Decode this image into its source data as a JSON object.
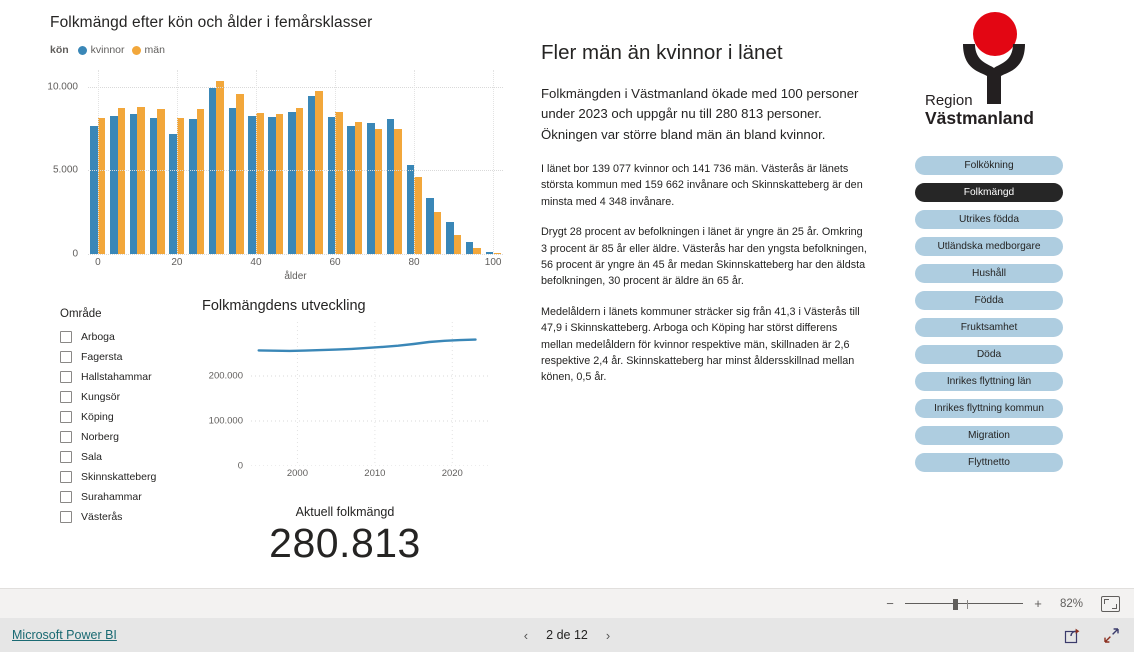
{
  "barchart": {
    "title": "Folkmängd efter kön och ålder i femårsklasser",
    "legend_title": "kön",
    "legend": [
      {
        "label": "kvinnor",
        "color": "#3a87b7"
      },
      {
        "label": "män",
        "color": "#f2a73b"
      }
    ]
  },
  "slicer": {
    "title": "Område",
    "items": [
      {
        "label": "Arboga",
        "checked": false
      },
      {
        "label": "Fagersta",
        "checked": false
      },
      {
        "label": "Hallstahammar",
        "checked": false
      },
      {
        "label": "Kungsör",
        "checked": false
      },
      {
        "label": "Köping",
        "checked": false
      },
      {
        "label": "Norberg",
        "checked": false
      },
      {
        "label": "Sala",
        "checked": false
      },
      {
        "label": "Skinnskatteberg",
        "checked": false
      },
      {
        "label": "Surahammar",
        "checked": false
      },
      {
        "label": "Västerås",
        "checked": false
      }
    ]
  },
  "linechart": {
    "title": "Folkmängdens utveckling"
  },
  "kpi": {
    "label": "Aktuell folkmängd",
    "value": "280.813"
  },
  "narrative": {
    "heading": "Fler män än kvinnor i länet",
    "lead": "Folkmängden i Västmanland ökade med 100 personer under 2023 och uppgår nu till 280 813 personer. Ökningen var större bland män än bland kvinnor.",
    "p1": "I länet bor 139 077 kvinnor och 141 736 män. Västerås är länets största kommun med 159 662 invånare och Skinnskatteberg är den minsta med 4 348 invånare.",
    "p2": "Drygt 28 procent av befolkningen i länet är yngre än 25 år. Omkring 3 procent är 85 år eller äldre. Västerås har den yngsta befolkningen, 56 procent är yngre än 45 år medan Skinnskatteberg har den äldsta befolkningen, 30 procent är äldre än 65 år.",
    "p3": "Medelåldern i länets kommuner sträcker sig från 41,3 i Västerås till 47,9 i Skinnskatteberg. Arboga och Köping har störst differens mellan medelåldern för kvinnor respektive män, skillnaden är 2,6 respektive 2,4 år. Skinnskatteberg har minst åldersskillnad mellan könen, 0,5 år."
  },
  "logo": {
    "line1": "Region",
    "line2": "Västmanland",
    "circle_color": "#e30613",
    "figure_color": "#231f20"
  },
  "nav": {
    "buttons": [
      {
        "label": "Folkökning",
        "active": false
      },
      {
        "label": "Folkmängd",
        "active": true
      },
      {
        "label": "Utrikes födda",
        "active": false
      },
      {
        "label": "Utländska medborgare",
        "active": false
      },
      {
        "label": "Hushåll",
        "active": false
      },
      {
        "label": "Födda",
        "active": false
      },
      {
        "label": "Fruktsamhet",
        "active": false
      },
      {
        "label": "Döda",
        "active": false
      },
      {
        "label": "Inrikes flyttning län",
        "active": false
      },
      {
        "label": "Inrikes flyttning kommun",
        "active": false
      },
      {
        "label": "Migration",
        "active": false
      },
      {
        "label": "Flyttnetto",
        "active": false
      }
    ],
    "active_color": "#262626",
    "inactive_color": "#aecde0"
  },
  "zoombar": {
    "minus": "−",
    "plus": "+",
    "percent": "82%"
  },
  "footer": {
    "brand": "Microsoft Power BI",
    "prev": "‹",
    "next": "›",
    "page_label": "2 de 12"
  },
  "chart_data": [
    {
      "type": "bar",
      "title": "Folkmängd efter kön och ålder i femårsklasser",
      "xlabel": "ålder",
      "ylabel": "",
      "ylim": [
        0,
        11000
      ],
      "yticks": [
        0,
        5000,
        10000
      ],
      "ytick_labels": [
        "0",
        "5.000",
        "10.000"
      ],
      "xticks": [
        0,
        20,
        40,
        60,
        80,
        100
      ],
      "xtick_labels": [
        "0",
        "20",
        "40",
        "60",
        "80",
        "100"
      ],
      "grid": true,
      "legend_position": "top-left",
      "categories": [
        "0",
        "5",
        "10",
        "15",
        "20",
        "25",
        "30",
        "35",
        "40",
        "45",
        "50",
        "55",
        "60",
        "65",
        "70",
        "75",
        "80",
        "85",
        "90",
        "95",
        "100"
      ],
      "series": [
        {
          "name": "kvinnor",
          "color": "#3a87b7",
          "values": [
            7650,
            8250,
            8350,
            8150,
            7200,
            8100,
            9900,
            8750,
            8250,
            8200,
            8500,
            9450,
            8200,
            7650,
            7850,
            8100,
            5300,
            3350,
            1900,
            700,
            150
          ]
        },
        {
          "name": "män",
          "color": "#f2a73b",
          "values": [
            8150,
            8750,
            8800,
            8650,
            8150,
            8650,
            10350,
            9550,
            8450,
            8350,
            8750,
            9750,
            8500,
            7900,
            7450,
            7500,
            4600,
            2500,
            1150,
            330,
            90
          ]
        }
      ]
    },
    {
      "type": "line",
      "title": "Folkmängdens utveckling",
      "xlabel": "",
      "ylabel": "",
      "ylim": [
        0,
        320000
      ],
      "yticks": [
        0,
        100000,
        200000
      ],
      "ytick_labels": [
        "0",
        "100.000",
        "200.000"
      ],
      "xticks": [
        2000,
        2010,
        2020
      ],
      "xtick_labels": [
        "2000",
        "2010",
        "2020"
      ],
      "grid": true,
      "line_color": "#3a87b7",
      "x": [
        1995,
        1997,
        1999,
        2001,
        2003,
        2005,
        2007,
        2009,
        2011,
        2013,
        2015,
        2017,
        2019,
        2021,
        2023
      ],
      "values": [
        257000,
        256200,
        255800,
        256500,
        257600,
        258600,
        260300,
        262400,
        264700,
        267300,
        271000,
        275500,
        278200,
        279800,
        280813
      ]
    }
  ]
}
